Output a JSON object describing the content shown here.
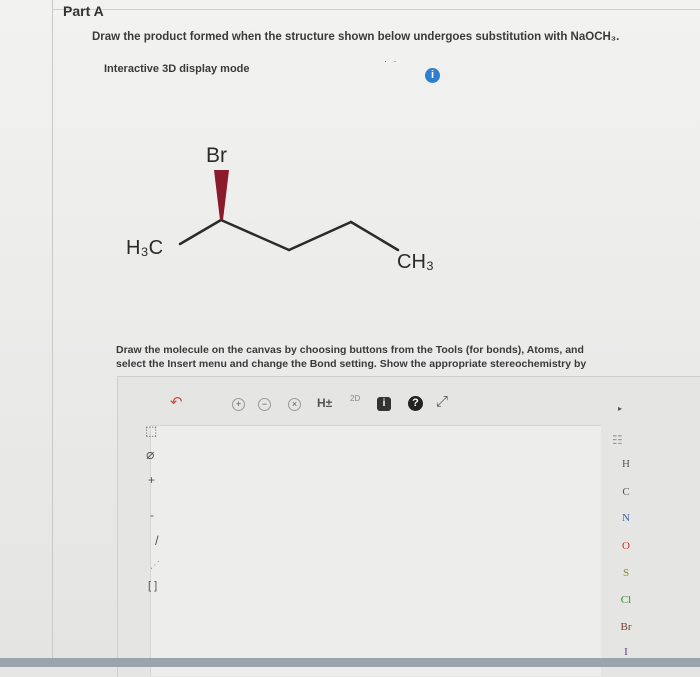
{
  "part": {
    "title": "Part A"
  },
  "question": {
    "text": "Draw the product formed when the structure shown below undergoes substitution with NaOCH₃."
  },
  "display_mode": {
    "label": "Interactive 3D display mode",
    "info_icon": "i"
  },
  "molecule": {
    "labels": {
      "br": "Br",
      "left": "H₃C",
      "right": "CH₃"
    }
  },
  "instructions": {
    "line1": "Draw the molecule on the canvas by choosing buttons from the Tools (for bonds), Atoms, and",
    "line2": "select the Insert menu and change the Bond setting. Show the appropriate stereochemistry by"
  },
  "toolbar": {
    "undo": "↶",
    "zoom_in": "+",
    "zoom_out": "−",
    "clear": "×",
    "hydrogens": "H±",
    "templates": "2D",
    "info": "i",
    "help": "?",
    "expand": "⤢"
  },
  "left_tools": {
    "select": "⬚",
    "eraser": "⌀",
    "charge_plus": "+",
    "charge_minus": "-",
    "bond": "/",
    "chain": "⋰",
    "bracket": "[ ]"
  },
  "atoms": {
    "periodic": "☷",
    "list": [
      "H",
      "C",
      "N",
      "O",
      "S",
      "Cl",
      "Br",
      "I"
    ],
    "colors": [
      "#555555",
      "#555555",
      "#4a5fa8",
      "#c0392b",
      "#8a8a2a",
      "#2e8b3a",
      "#7a3b2a",
      "#6a3a8a"
    ]
  },
  "colors": {
    "accent": "#2f7fd0",
    "wedge": "#8b1a2a"
  }
}
